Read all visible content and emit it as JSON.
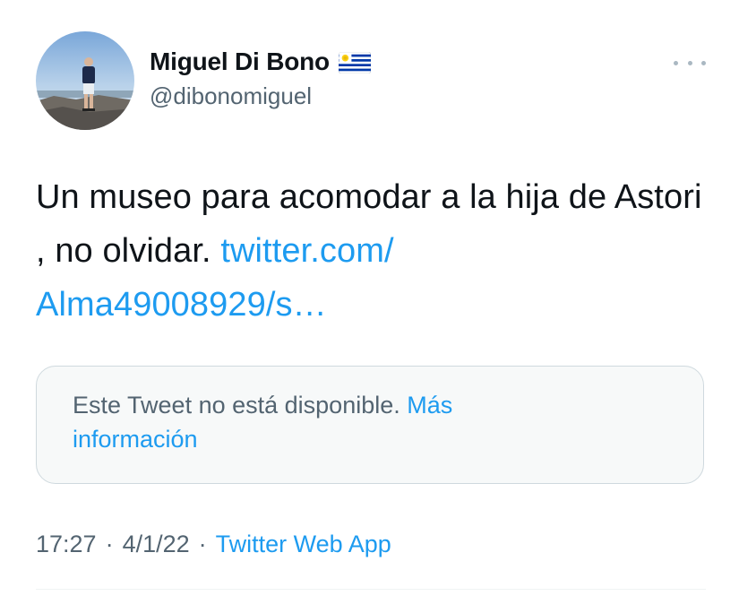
{
  "author": {
    "display_name": "Miguel Di Bono",
    "flag_icon": "uruguay-flag",
    "handle": "@dibonomiguel"
  },
  "tweet": {
    "text": "Un museo para acomodar a la hija de Astori , no olvidar. ",
    "link_line1": "twitter.com/",
    "link_line2": "Alma49008929/s…"
  },
  "quoted": {
    "unavailable_text": "Este Tweet no está disponible. ",
    "more_info_part1": "Más",
    "more_info_part2": "información"
  },
  "meta": {
    "time": "17:27",
    "date": "4/1/22",
    "separator": "·",
    "source": "Twitter Web App"
  },
  "colors": {
    "link": "#1d9bf0",
    "secondary_text": "#536471",
    "border": "#cfd9de"
  }
}
